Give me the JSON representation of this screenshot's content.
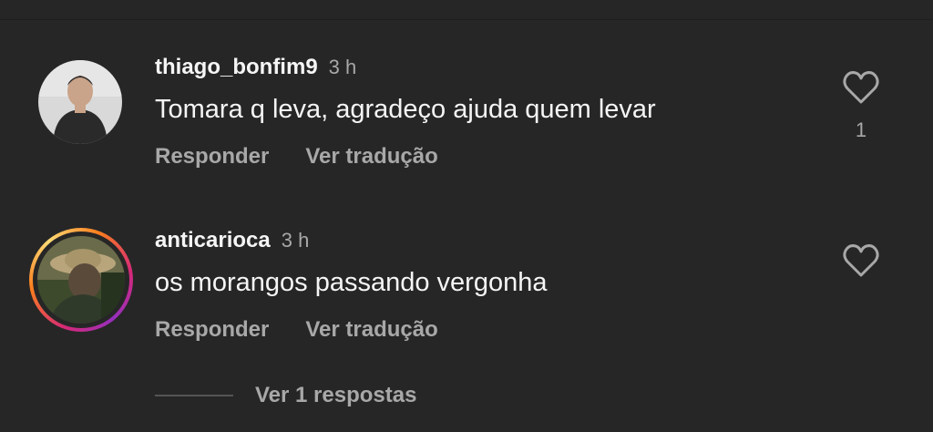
{
  "comments": [
    {
      "username": "thiago_bonfim9",
      "time": "3 h",
      "text": "Tomara q leva, agradeço ajuda quem levar",
      "reply_label": "Responder",
      "translate_label": "Ver tradução",
      "like_count": "1",
      "avatar": "user-photo",
      "has_story_ring": false
    },
    {
      "username": "anticarioca",
      "time": "3 h",
      "text": "os morangos passando vergonha",
      "reply_label": "Responder",
      "translate_label": "Ver tradução",
      "like_count": "",
      "avatar": "user-photo",
      "has_story_ring": true
    }
  ],
  "replies": {
    "label": "Ver 1 respostas"
  },
  "icons": {
    "like": "heart-outline-icon"
  },
  "colors": {
    "background": "#262626",
    "text_primary": "#f5f5f5",
    "text_secondary": "#a8a8a8",
    "story_ring": [
      "#d62976",
      "#fa7e1e",
      "#feda75",
      "#962fbf"
    ]
  }
}
